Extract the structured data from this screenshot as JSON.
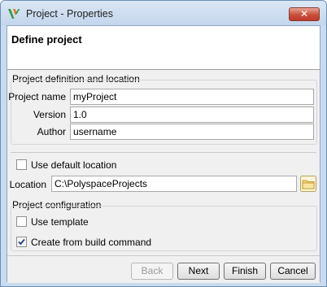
{
  "window": {
    "title": "Project - Properties",
    "close_glyph": "✕"
  },
  "header": {
    "title": "Define project"
  },
  "definition": {
    "section_label": "Project definition and location",
    "project_name_label": "Project name",
    "project_name_value": "myProject",
    "version_label": "Version",
    "version_value": "1.0",
    "author_label": "Author",
    "author_value": "username",
    "use_default_location_label": "Use default location",
    "use_default_location_checked": false,
    "location_label": "Location",
    "location_value": "C:\\PolyspaceProjects"
  },
  "configuration": {
    "section_label": "Project configuration",
    "use_template_label": "Use template",
    "use_template_checked": false,
    "build_command_label": "Create from build command",
    "build_command_checked": true
  },
  "buttons": {
    "back": "Back",
    "next": "Next",
    "finish": "Finish",
    "cancel": "Cancel"
  },
  "icons": {
    "app": "polyspace-logo-icon",
    "folder": "folder-icon",
    "close": "close-icon"
  },
  "colors": {
    "title_bar": "#c3d6ec",
    "close_button": "#c9503a",
    "dialog_background": "#f0f0f0",
    "logo_green": "#2e9b3c",
    "logo_orange": "#e07a1f"
  }
}
